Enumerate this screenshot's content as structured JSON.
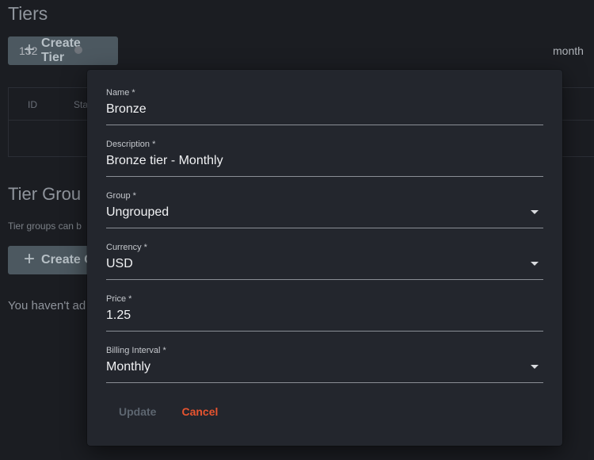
{
  "page": {
    "title": "Tiers",
    "create_tier_label": "Create Tier",
    "table": {
      "headers": [
        "ID",
        "Sta"
      ],
      "rows": [
        {
          "id": "132",
          "interval_fragment": "month"
        }
      ]
    },
    "groups_title": "Tier Grou",
    "groups_help": "Tier groups can b",
    "create_group_label": "Create G",
    "empty_note": "You haven't ad"
  },
  "modal": {
    "fields": {
      "name": {
        "label": "Name *",
        "value": "Bronze"
      },
      "description": {
        "label": "Description *",
        "value": "Bronze tier - Monthly"
      },
      "group": {
        "label": "Group *",
        "value": "Ungrouped"
      },
      "currency": {
        "label": "Currency *",
        "value": "USD"
      },
      "price": {
        "label": "Price *",
        "value": "1.25"
      },
      "billing_interval": {
        "label": "Billing Interval *",
        "value": "Monthly"
      }
    },
    "update_label": "Update",
    "cancel_label": "Cancel"
  },
  "colors": {
    "background": "#1b1d22",
    "modal": "#23262d",
    "button": "#4c5860",
    "cancel_accent": "#e8542f",
    "update_disabled": "#5d6670"
  },
  "icons": {
    "create_tier": "plus-icon",
    "create_group": "plus-icon",
    "select": "caret-down-icon"
  }
}
